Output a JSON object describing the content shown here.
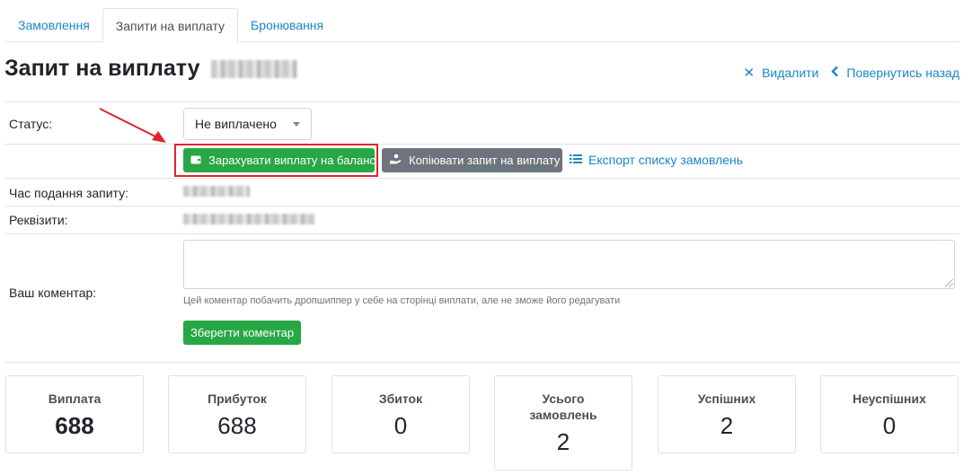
{
  "tabs": [
    {
      "label": "Замовлення"
    },
    {
      "label": "Запити на виплату"
    },
    {
      "label": "Бронювання"
    }
  ],
  "page": {
    "title": "Запит на виплату"
  },
  "actions": {
    "delete_label": "Видалити",
    "back_label": "Повернутись назад"
  },
  "form": {
    "status_label": "Статус:",
    "status_value": "Не виплачено",
    "credit_button": "Зарахувати виплату на баланс",
    "copy_button": "Копіювати запит на виплату",
    "export_link": "Експорт списку замовлень",
    "submit_time_label": "Час подання запиту:",
    "requisites_label": "Реквізити:",
    "comment_label": "Ваш коментар:",
    "comment_hint": "Цей коментар побачить дропшиппер у себе на сторінці виплати, але не зможе його редагувати",
    "save_comment_button": "Зберегти коментар"
  },
  "stats": [
    {
      "title": "Виплата",
      "value": "688"
    },
    {
      "title": "Прибуток",
      "value": "688"
    },
    {
      "title": "Збиток",
      "value": "0"
    },
    {
      "title": "Усього замовлень",
      "value": "2"
    },
    {
      "title": "Успішних",
      "value": "2"
    },
    {
      "title": "Неуспішних",
      "value": "0"
    }
  ],
  "colors": {
    "link": "#1a86c8",
    "success": "#28a745",
    "secondary": "#6c757d",
    "annotation": "#e0242b"
  }
}
